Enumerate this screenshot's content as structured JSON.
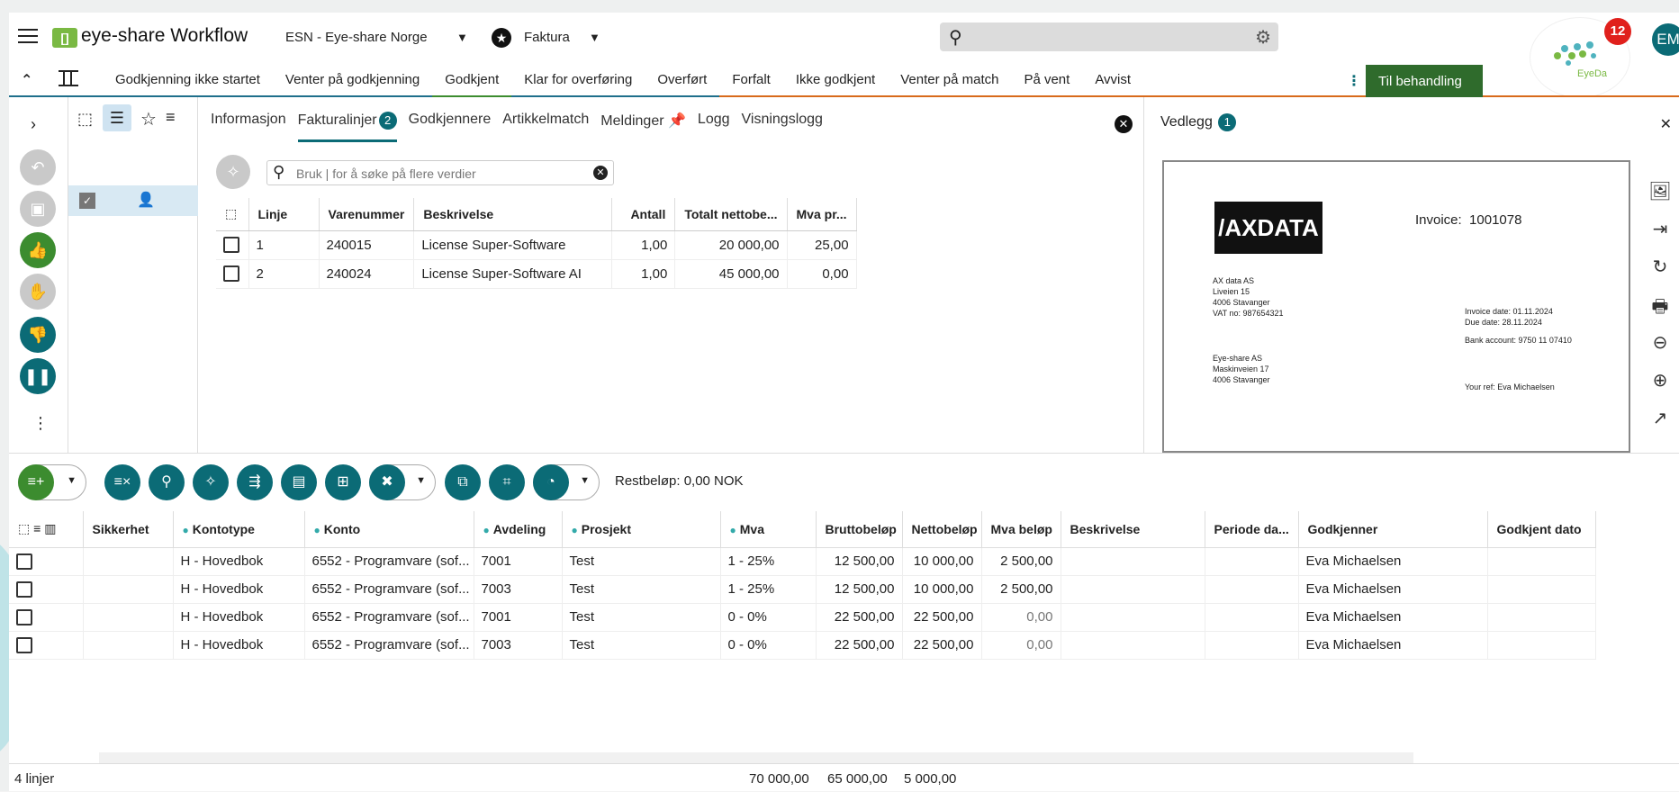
{
  "app": {
    "title": "eye-share Workflow",
    "logo_text": "[]",
    "company": "ESN - Eye-share Norge",
    "module": "Faktura",
    "notifications": "12",
    "user_initials": "EM",
    "assistant": "EyeDa"
  },
  "status_tabs": [
    "Godkjenning ikke startet",
    "Venter på godkjenning",
    "Godkjent",
    "Klar for overføring",
    "Overført",
    "Forfalt",
    "Ikke godkjent",
    "Venter på match",
    "På vent",
    "Avvist"
  ],
  "status_colors": [
    "#1f6f8b",
    "#1f6f8b",
    "#3c8c2f",
    "#1f6f8b",
    "#1f6f8b",
    "#d86a1b",
    "#d86a1b",
    "#d86a1b",
    "#d86a1b",
    "#d86a1b"
  ],
  "til_behandling": "Til behandling",
  "detail_tabs": {
    "informasjon": "Informasjon",
    "fakturalinjer": "Fakturalinjer",
    "fakturalinjer_count": "2",
    "godkjennere": "Godkjennere",
    "artikkelmatch": "Artikkelmatch",
    "meldinger": "Meldinger",
    "logg": "Logg",
    "visningslogg": "Visningslogg"
  },
  "search": {
    "placeholder": "Bruk | for å søke på flere verdier"
  },
  "invoice_lines": {
    "headers": [
      "Linje",
      "Varenummer",
      "Beskrivelse",
      "Antall",
      "Totalt nettobe...",
      "Mva pr..."
    ],
    "rows": [
      [
        "1",
        "240015",
        "License Super-Software",
        "1,00",
        "20 000,00",
        "25,00"
      ],
      [
        "2",
        "240024",
        "License Super-Software AI",
        "1,00",
        "45 000,00",
        "0,00"
      ]
    ]
  },
  "vedlegg": {
    "title": "Vedlegg",
    "count": "1"
  },
  "invoice_doc": {
    "logo": "/AXDATA",
    "invoice_label": "Invoice:",
    "invoice_no": "1001078",
    "sender": "AX data AS\nLiveien 15\n4006 Stavanger\nVAT no: 987654321",
    "dates": "Invoice date: 01.11.2024\nDue date: 28.11.2024",
    "bank": "Bank account: 9750 11 07410",
    "recipient": "Eye-share AS\nMaskinveien 17\n4006 Stavanger",
    "your_ref": "Your ref: Eva Michaelsen"
  },
  "restbelop": "Restbeløp: 0,00 NOK",
  "account_lines": {
    "headers": [
      "Sikkerhet",
      "Kontotype",
      "Konto",
      "Avdeling",
      "Prosjekt",
      "Mva",
      "Bruttobeløp",
      "Nettobeløp",
      "Mva beløp",
      "Beskrivelse",
      "Periode da...",
      "Godkjenner",
      "Godkjent dato"
    ],
    "rows": [
      [
        "",
        "H - Hovedbok",
        "6552 - Programvare (sof...",
        "7001",
        "Test",
        "1 - 25%",
        "12 500,00",
        "10 000,00",
        "2 500,00",
        "",
        "",
        "Eva Michaelsen",
        ""
      ],
      [
        "",
        "H - Hovedbok",
        "6552 - Programvare (sof...",
        "7003",
        "Test",
        "1 - 25%",
        "12 500,00",
        "10 000,00",
        "2 500,00",
        "",
        "",
        "Eva Michaelsen",
        ""
      ],
      [
        "",
        "H - Hovedbok",
        "6552 - Programvare (sof...",
        "7001",
        "Test",
        "0 - 0%",
        "22 500,00",
        "22 500,00",
        "0,00",
        "",
        "",
        "Eva Michaelsen",
        ""
      ],
      [
        "",
        "H - Hovedbok",
        "6552 - Programvare (sof...",
        "7003",
        "Test",
        "0 - 0%",
        "22 500,00",
        "22 500,00",
        "0,00",
        "",
        "",
        "Eva Michaelsen",
        ""
      ]
    ]
  },
  "footer": {
    "count": "4 linjer",
    "brutto": "70 000,00",
    "netto": "65 000,00",
    "mva": "5 000,00"
  }
}
